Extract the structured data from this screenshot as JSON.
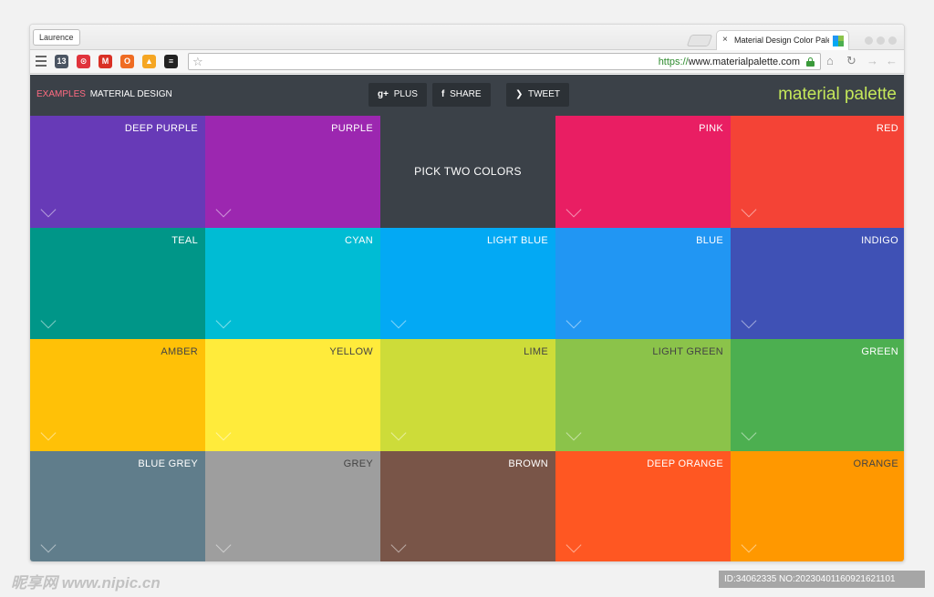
{
  "browser": {
    "profile_button": "Laurence",
    "tab": {
      "title": "Material Design Color Pale",
      "close": "×"
    },
    "favicon_colors": [
      "#2196f3",
      "#8bc34a",
      "#03a9f4",
      "#4caf50"
    ],
    "url_scheme": "https://",
    "url_host": "www.materialpalette.com",
    "extensions": [
      {
        "name": "tab-count-icon",
        "text": "13",
        "color": "#4b5563"
      },
      {
        "name": "pocket-icon",
        "text": "⊙",
        "color": "#e0333c"
      },
      {
        "name": "gmail-icon",
        "text": "M",
        "color": "#d93025"
      },
      {
        "name": "opera-icon",
        "text": "O",
        "color": "#ef6c23"
      },
      {
        "name": "photos-icon",
        "text": "▲",
        "color": "#f5a623"
      },
      {
        "name": "buffer-icon",
        "text": "≡",
        "color": "#222222"
      }
    ]
  },
  "header": {
    "examples": "EXAMPLES",
    "material_design": "MATERIAL DESIGN",
    "buttons": [
      {
        "name": "plus-button",
        "glyph": "g+",
        "label": "PLUS"
      },
      {
        "name": "share-button",
        "glyph": "f",
        "label": "SHARE"
      },
      {
        "name": "tweet-button",
        "glyph": "❯",
        "label": "TWEET"
      }
    ],
    "brand": "material palette"
  },
  "grid": {
    "rows": [
      [
        {
          "label": "DEEP PURPLE",
          "color": "#673ab7",
          "text_color": "#ffffff"
        },
        {
          "label": "PURPLE",
          "color": "#9c27b0",
          "text_color": "#ffffff"
        },
        {
          "label": "PICK TWO COLORS",
          "color": "#3b4148",
          "text_color": "#ffffff",
          "center": true
        },
        {
          "label": "PINK",
          "color": "#e91e63",
          "text_color": "#ffffff"
        },
        {
          "label": "RED",
          "color": "#f44336",
          "text_color": "#ffffff"
        }
      ],
      [
        {
          "label": "TEAL",
          "color": "#009688",
          "text_color": "#ffffff"
        },
        {
          "label": "CYAN",
          "color": "#00bcd4",
          "text_color": "#ffffff"
        },
        {
          "label": "LIGHT BLUE",
          "color": "#03a9f4",
          "text_color": "#ffffff"
        },
        {
          "label": "BLUE",
          "color": "#2196f3",
          "text_color": "#ffffff"
        },
        {
          "label": "INDIGO",
          "color": "#3f51b5",
          "text_color": "#ffffff"
        }
      ],
      [
        {
          "label": "AMBER",
          "color": "#ffc107",
          "text_color": "#444444"
        },
        {
          "label": "YELLOW",
          "color": "#ffeb3b",
          "text_color": "#444444"
        },
        {
          "label": "LIME",
          "color": "#cddc39",
          "text_color": "#444444"
        },
        {
          "label": "LIGHT GREEN",
          "color": "#8bc34a",
          "text_color": "#444444"
        },
        {
          "label": "GREEN",
          "color": "#4caf50",
          "text_color": "#ffffff"
        }
      ],
      [
        {
          "label": "BLUE GREY",
          "color": "#607d8b",
          "text_color": "#ffffff"
        },
        {
          "label": "GREY",
          "color": "#9e9e9e",
          "text_color": "#444444"
        },
        {
          "label": "BROWN",
          "color": "#795548",
          "text_color": "#ffffff"
        },
        {
          "label": "DEEP ORANGE",
          "color": "#ff5722",
          "text_color": "#ffffff"
        },
        {
          "label": "ORANGE",
          "color": "#ff9800",
          "text_color": "#444444"
        }
      ]
    ]
  },
  "watermark": {
    "left": "昵享网 www.nipic.cn",
    "right": "ID:34062335 NO:20230401160921621101"
  }
}
